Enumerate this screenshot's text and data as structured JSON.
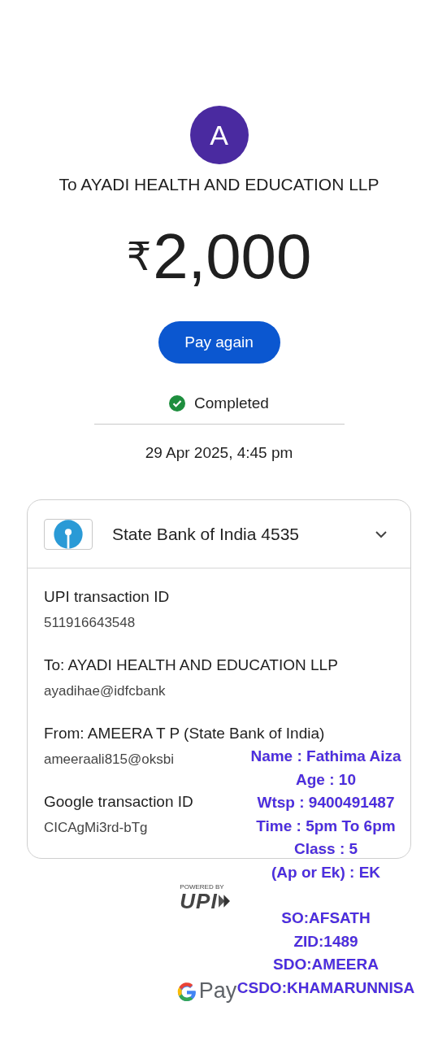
{
  "payee": {
    "avatar_letter": "A",
    "title": "To AYADI HEALTH AND EDUCATION LLP"
  },
  "amount": {
    "currency": "₹",
    "value": "2,000"
  },
  "action_button": "Pay again",
  "status": {
    "label": "Completed",
    "completed": true
  },
  "date": "29 Apr 2025, 4:45 pm",
  "details_card": {
    "account": "State Bank of India 4535",
    "expanded": true,
    "items": [
      {
        "label": "UPI transaction ID",
        "value": "511916643548"
      },
      {
        "label": "To: AYADI HEALTH AND EDUCATION LLP",
        "value": "ayadihae@idfcbank"
      },
      {
        "label": "From: AMEERA  T P (State Bank of India)",
        "value": "ameeraali815@oksbi"
      },
      {
        "label": "Google transaction ID",
        "value": "CICAgMi3rd-bTg"
      }
    ]
  },
  "footer": {
    "powered_by": "POWERED BY",
    "upi": "UPI",
    "brand": "Pay"
  },
  "overlay_note": {
    "blocks": [
      [
        "Name : Fathima Aiza",
        "Age : 10",
        "Wtsp : 9400491487",
        "Time : 5pm To 6pm",
        "Class : 5",
        "(Ap or Ek) : EK"
      ],
      [
        "SO:AFSATH",
        "ZID:1489",
        "SDO:AMEERA",
        "CSDO:KHAMARUNNISA"
      ]
    ]
  }
}
